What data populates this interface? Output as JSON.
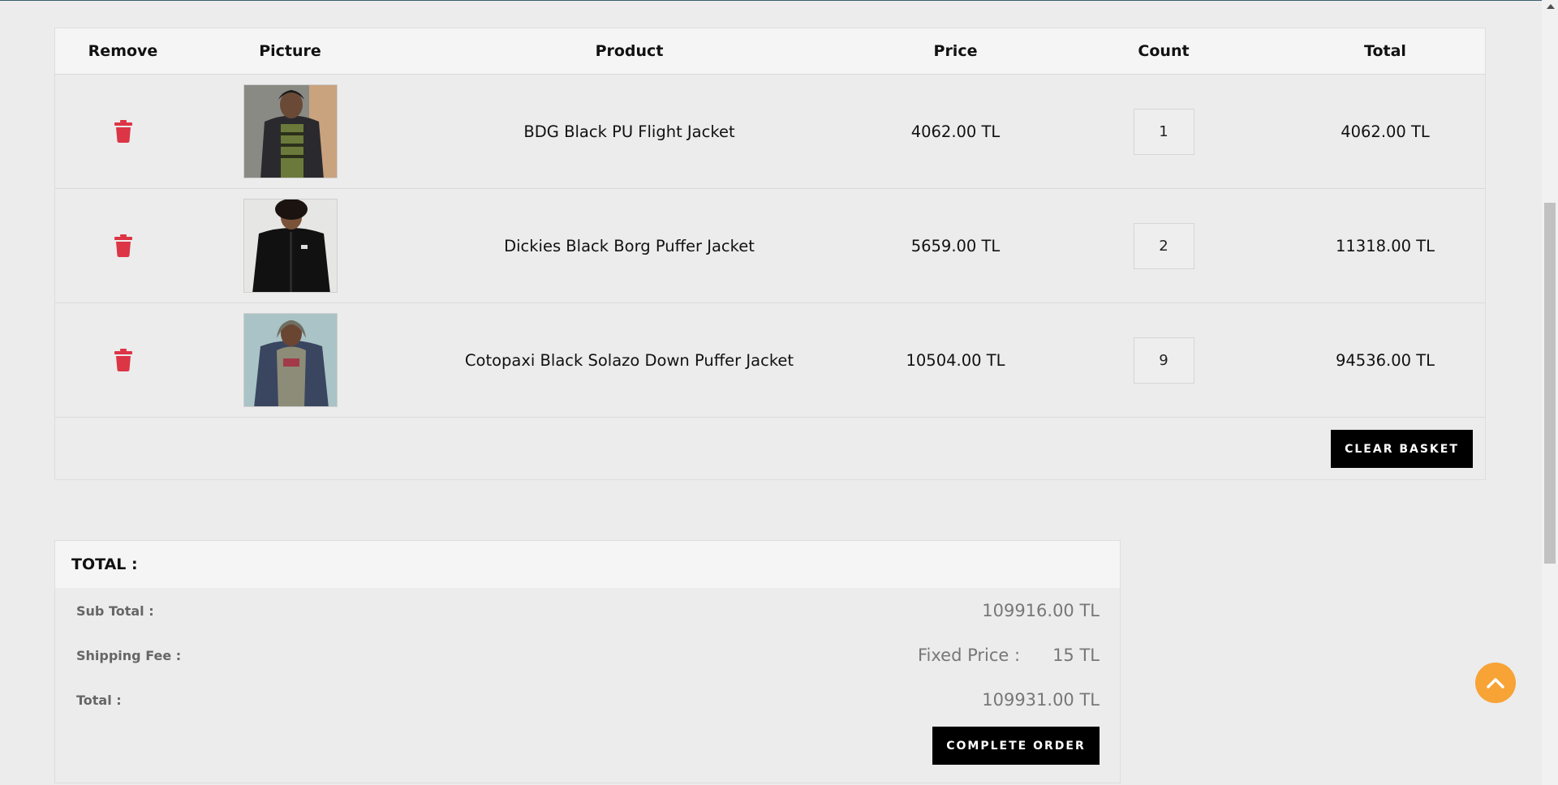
{
  "cart": {
    "headers": {
      "remove": "Remove",
      "picture": "Picture",
      "product": "Product",
      "price": "Price",
      "count": "Count",
      "total": "Total"
    },
    "items": [
      {
        "name": "BDG Black PU Flight Jacket",
        "price": "4062.00 TL",
        "count": "1",
        "total": "4062.00 TL"
      },
      {
        "name": "Dickies Black Borg Puffer Jacket",
        "price": "5659.00 TL",
        "count": "2",
        "total": "11318.00 TL"
      },
      {
        "name": "Cotopaxi Black Solazo Down Puffer Jacket",
        "price": "10504.00 TL",
        "count": "9",
        "total": "94536.00 TL"
      }
    ],
    "clear_label": "CLEAR BASKET"
  },
  "totals": {
    "heading": "TOTAL :",
    "subtotal_label": "Sub Total :",
    "subtotal_value": "109916.00 TL",
    "shipping_label": "Shipping Fee :",
    "shipping_type": "Fixed Price :",
    "shipping_value": "15 TL",
    "total_label": "Total :",
    "total_value": "109931.00 TL",
    "complete_label": "COMPLETE ORDER"
  },
  "icons": {
    "remove": "trash-icon",
    "back_to_top": "chevron-up-icon"
  },
  "colors": {
    "trash": "#dc3545",
    "button": "#000000",
    "back_to_top": "#f7a336"
  }
}
